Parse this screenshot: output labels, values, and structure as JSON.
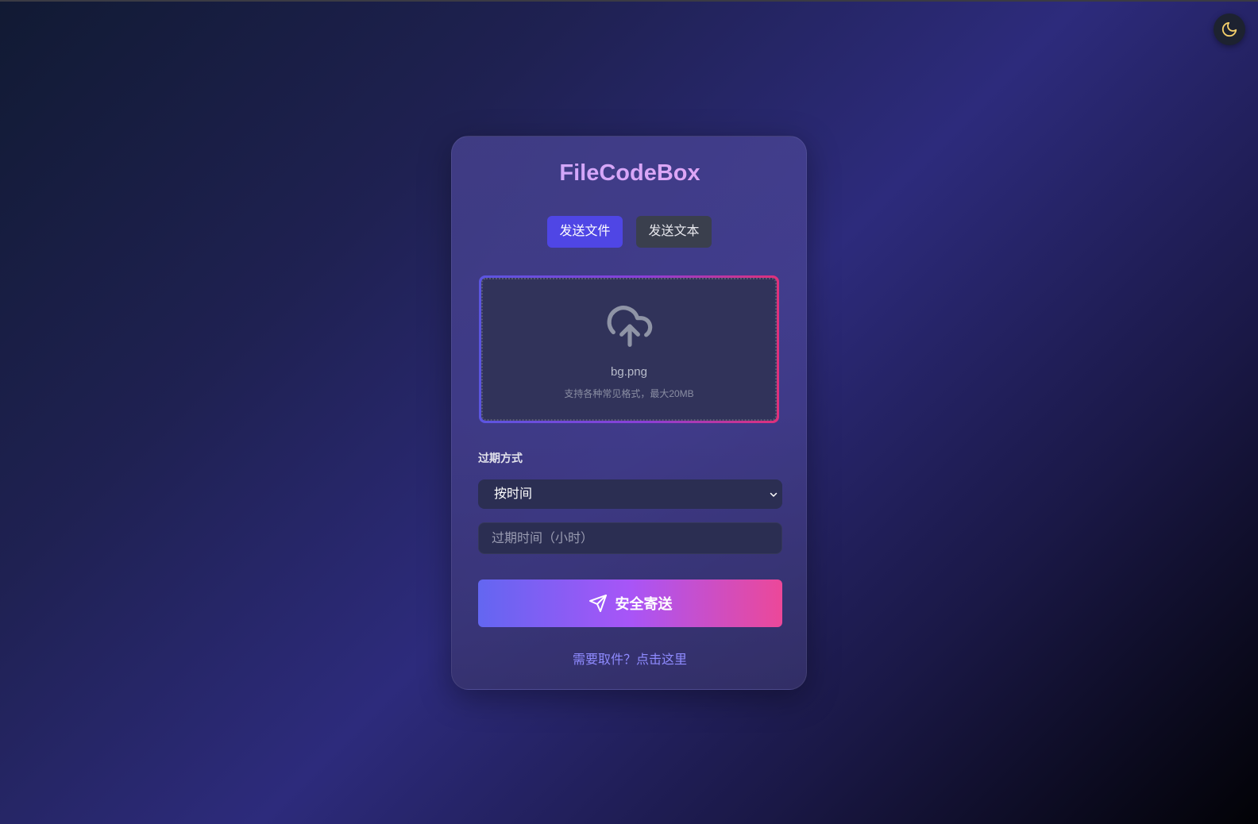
{
  "app": {
    "title": "FileCodeBox"
  },
  "theme_toggle": {
    "icon": "moon-icon",
    "icon_color": "#f5d06b"
  },
  "tabs": [
    {
      "label": "发送文件",
      "active": true
    },
    {
      "label": "发送文本",
      "active": false
    }
  ],
  "dropzone": {
    "icon": "cloud-upload-icon",
    "file_name": "bg.png",
    "hint": "支持各种常见格式，最大20MB"
  },
  "expiry": {
    "label": "过期方式",
    "selected": "按时间",
    "input_placeholder": "过期时间（小时）"
  },
  "submit": {
    "icon": "send-icon",
    "label": "安全寄送"
  },
  "footer": {
    "link_text": "需要取件？点击这里"
  },
  "colors": {
    "accent": "#4f46e5",
    "gradient_start": "#6366f1",
    "gradient_end": "#ec4899",
    "link": "#8f8bff"
  }
}
